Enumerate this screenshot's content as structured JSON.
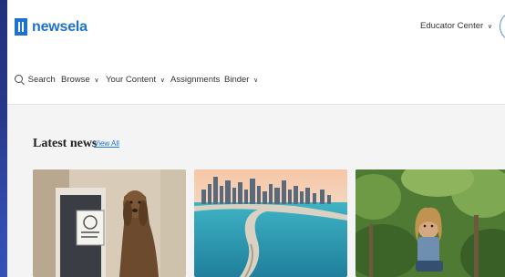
{
  "header": {
    "logo_text": "newsela",
    "educator_center": "Educator Center",
    "educator_chevron": "∨"
  },
  "nav": {
    "search_label": "Search",
    "items": [
      {
        "label": "Browse",
        "chevron": "∨"
      },
      {
        "label": "Your Content",
        "chevron": "∨"
      },
      {
        "label": "Assignments",
        "chevron": ""
      },
      {
        "label": "Binder",
        "chevron": "∨"
      }
    ]
  },
  "latest": {
    "title": "Latest news",
    "view_all": "View All"
  },
  "colors": {
    "brand": "#1c72cf",
    "background": "#f4f4f4"
  },
  "icons": [
    "logo-icon",
    "search-icon",
    "chevron-down-icon"
  ]
}
